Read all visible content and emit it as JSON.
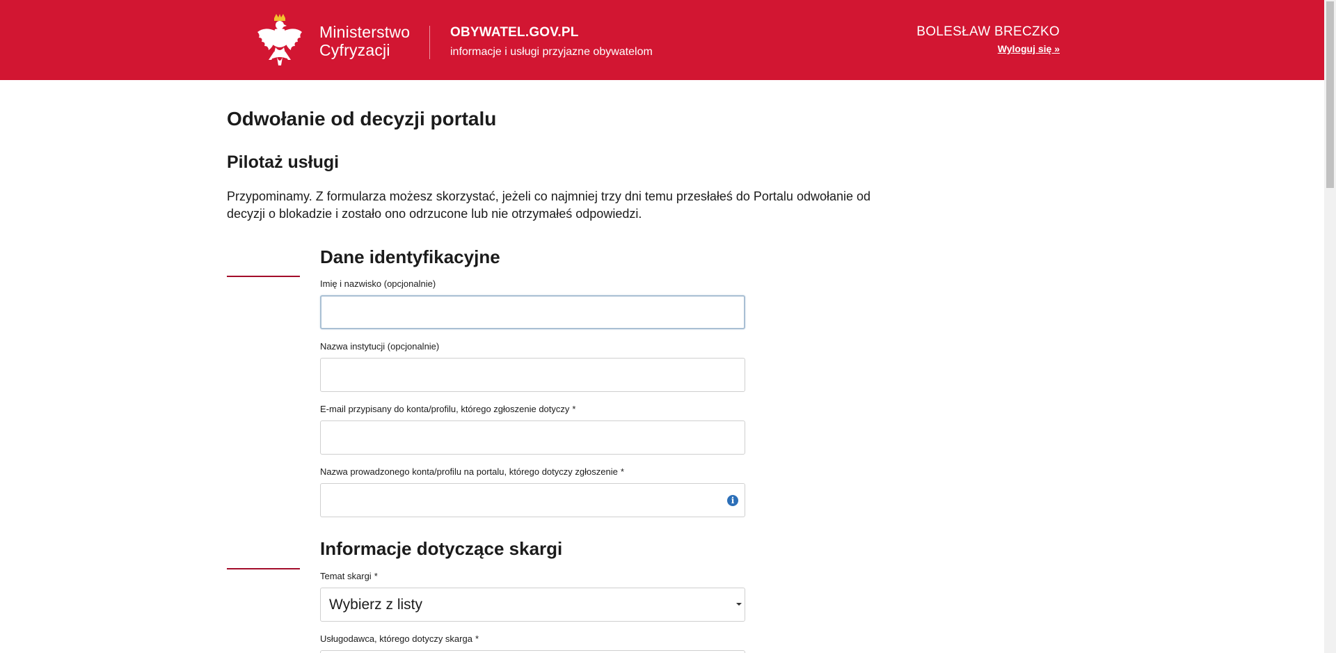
{
  "header": {
    "ministry_line1": "Ministerstwo",
    "ministry_line2": "Cyfryzacji",
    "portal_name": "OBYWATEL.GOV.PL",
    "portal_tagline": "informacje i usługi przyjazne obywatelom",
    "user_name": "BOLESŁAW BRECZKO",
    "logout_label": "Wyloguj się »",
    "brand_color": "#d21632"
  },
  "page": {
    "title": "Odwołanie od decyzji portalu",
    "subtitle": "Pilotaż usługi",
    "intro_line1": "Przypominamy. Z formularza możesz skorzystać, jeżeli co najmniej trzy dni temu przesłałeś do Portalu odwołanie od",
    "intro_line2": "decyzji o blokadzie i zostało ono odrzucone lub nie otrzymałeś odpowiedzi."
  },
  "sections": {
    "identification": {
      "title": "Dane identyfikacyjne",
      "fields": [
        {
          "label": "Imię i nazwisko (opcjonalnie)",
          "value": "",
          "required": false
        },
        {
          "label": "Nazwa instytucji (opcjonalnie)",
          "value": "",
          "required": false
        },
        {
          "label": "E-mail przypisany do konta/profilu, którego zgłoszenie dotyczy",
          "value": "",
          "required": true
        },
        {
          "label": "Nazwa prowadzonego konta/profilu na portalu, którego dotyczy zgłoszenie",
          "value": "",
          "required": true
        }
      ]
    },
    "complaint": {
      "title": "Informacje dotyczące skargi",
      "topic_label": "Temat skargi",
      "topic_selected": "Wybierz z listy",
      "provider_label": "Usługodawca, którego dotyczy skarga"
    }
  },
  "required_marker": "*",
  "icons": {
    "emblem": "polish-eagle-icon",
    "info": "info-icon",
    "caret": "caret-down-icon"
  }
}
